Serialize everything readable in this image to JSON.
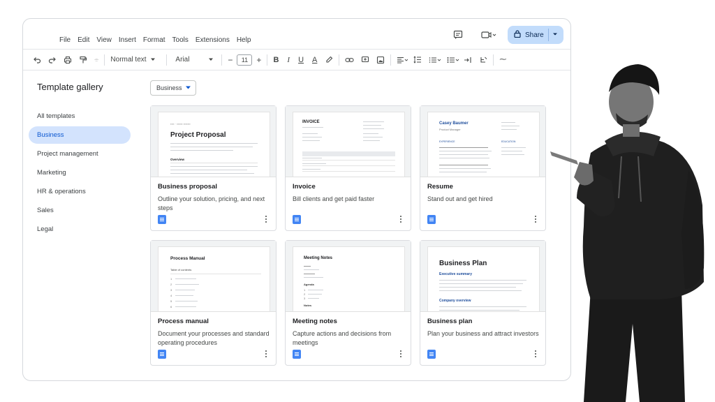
{
  "menu": [
    "File",
    "Edit",
    "View",
    "Insert",
    "Format",
    "Tools",
    "Extensions",
    "Help"
  ],
  "share_label": "Share",
  "toolbar": {
    "style": "Normal text",
    "font": "Arial",
    "size": "11"
  },
  "sidebar": {
    "title": "Template gallery",
    "items": [
      "All templates",
      "Business",
      "Project management",
      "Marketing",
      "HR & operations",
      "Sales",
      "Legal"
    ],
    "active": "Business"
  },
  "filter": "Business",
  "cards": [
    {
      "title": "Business proposal",
      "desc": "Outline your solution, pricing, and next steps",
      "thumb_title": "Project Proposal",
      "thumb_sub": "Overview",
      "thumb_head": "Proposal"
    },
    {
      "title": "Invoice",
      "desc": "Bill clients and get paid faster",
      "thumb_title": "INVOICE"
    },
    {
      "title": "Resume",
      "desc": "Stand out and get hired",
      "thumb_title": "Casey Baumer",
      "thumb_sub": "Product Manager",
      "thumb_s1": "EXPERIENCE",
      "thumb_s2": "EDUCATION"
    },
    {
      "title": "Process manual",
      "desc": "Document your processes and standard operating procedures",
      "thumb_title": "Process Manual",
      "thumb_sub": "Table of contents"
    },
    {
      "title": "Meeting notes",
      "desc": "Capture actions and decisions from meetings",
      "thumb_title": "Meeting Notes",
      "thumb_sub": "Agenda",
      "thumb_s2": "Notes"
    },
    {
      "title": "Business plan",
      "desc": "Plan your business and attract investors",
      "thumb_title": "Business Plan",
      "thumb_sub": "Executive summary",
      "thumb_s2": "Company overview"
    }
  ],
  "colors": {
    "accent": "#0b57d0",
    "share_bg": "#c2dcfb",
    "active_bg": "#d3e3fd",
    "docs_blue": "#4285f4"
  }
}
